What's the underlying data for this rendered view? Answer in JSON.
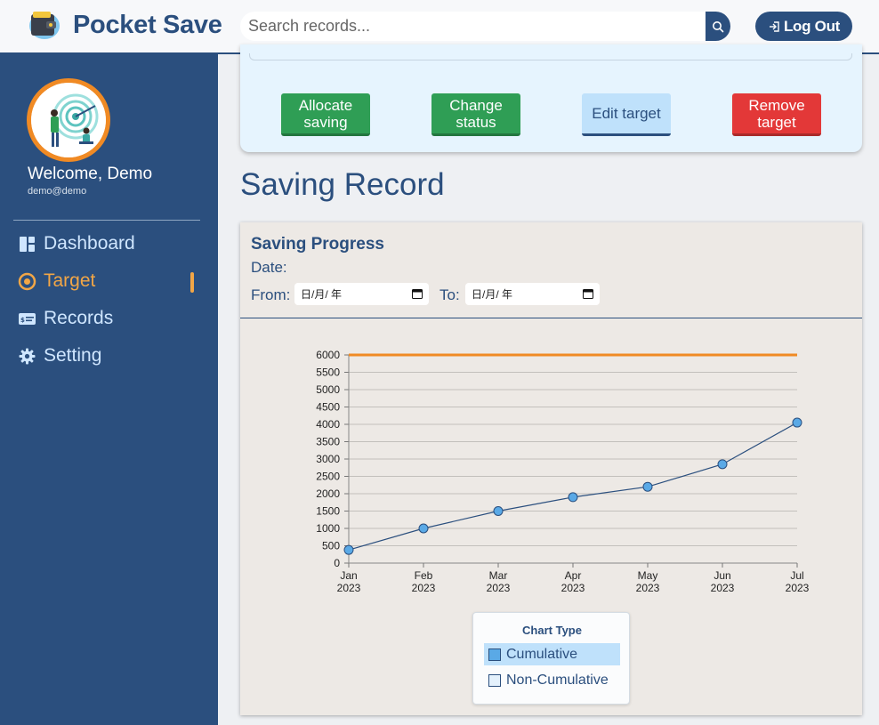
{
  "header": {
    "app_name": "Pocket Save",
    "search_placeholder": "Search records...",
    "logout_label": "Log Out"
  },
  "sidebar": {
    "welcome": "Welcome, Demo",
    "email": "demo@demo",
    "items": [
      {
        "label": "Dashboard",
        "icon": "dashboard-icon",
        "active": false
      },
      {
        "label": "Target",
        "icon": "target-icon",
        "active": true
      },
      {
        "label": "Records",
        "icon": "records-icon",
        "active": false
      },
      {
        "label": "Setting",
        "icon": "gear-icon",
        "active": false
      }
    ]
  },
  "target_panel": {
    "buttons": [
      {
        "label": "Allocate saving",
        "color": "#2f9e55"
      },
      {
        "label": "Change status",
        "color": "#2f9e55"
      },
      {
        "label": "Edit target",
        "color": "#bfe1fb"
      },
      {
        "label": "Remove target",
        "color": "#e33838"
      }
    ]
  },
  "page": {
    "heading": "Saving Record"
  },
  "progress_card": {
    "title": "Saving Progress",
    "date_label": "Date:",
    "from_label": "From:",
    "to_label": "To:",
    "from_value": "日/月/ 年",
    "to_value": "日/月/ 年"
  },
  "chart_legend": {
    "title": "Chart Type",
    "options": [
      {
        "label": "Cumulative",
        "selected": true
      },
      {
        "label": "Non-Cumulative",
        "selected": false
      }
    ]
  },
  "colors": {
    "primary": "#2b4f7e",
    "accent": "#f08a24",
    "target_line": "#f08a24",
    "series_line": "#2b4f7e",
    "point_fill": "#5aa9e6"
  },
  "chart_data": {
    "type": "line",
    "title": "",
    "xlabel": "",
    "ylabel": "",
    "categories": [
      [
        "Jan",
        "2023"
      ],
      [
        "Feb",
        "2023"
      ],
      [
        "Mar",
        "2023"
      ],
      [
        "Apr",
        "2023"
      ],
      [
        "May",
        "2023"
      ],
      [
        "Jun",
        "2023"
      ],
      [
        "Jul",
        "2023"
      ]
    ],
    "series": [
      {
        "name": "",
        "values": [
          380,
          1000,
          1500,
          1900,
          2200,
          2850,
          4050
        ]
      }
    ],
    "target": 6000,
    "ylim": [
      0,
      6000
    ],
    "yticks": [
      0,
      500,
      1000,
      1500,
      2000,
      2500,
      3000,
      3500,
      4000,
      4500,
      5000,
      5500,
      6000
    ],
    "grid": true
  }
}
